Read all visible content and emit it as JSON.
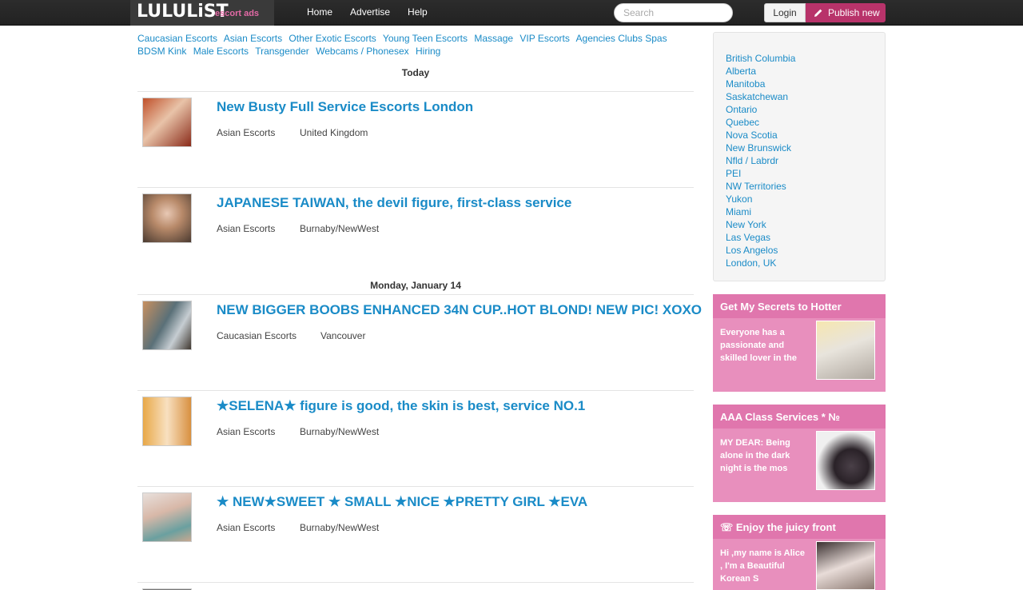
{
  "header": {
    "logo": "LULULiST",
    "logo_sub": "escort ads",
    "nav": [
      "Home",
      "Advertise",
      "Help"
    ],
    "search_placeholder": "Search",
    "login": "Login",
    "publish": "Publish new"
  },
  "categories": [
    "Caucasian Escorts",
    "Asian Escorts",
    "Other Exotic Escorts",
    "Young Teen Escorts",
    "Massage",
    "VIP Escorts",
    "Agencies Clubs Spas",
    "BDSM Kink",
    "Male Escorts",
    "Transgender",
    "Webcams / Phonesex",
    "Hiring"
  ],
  "dates": [
    "Today",
    "Monday, January 14"
  ],
  "listings": [
    {
      "title": "New Busty Full Service Escorts London",
      "category": "Asian Escorts",
      "location": "United Kingdom"
    },
    {
      "title": "JAPANESE TAIWAN, the devil figure, first-class service",
      "category": "Asian Escorts",
      "location": "Burnaby/NewWest"
    },
    {
      "title": "NEW BIGGER BOOBS ENHANCED 34N CUP..HOT BLOND! NEW PIC! XOXO",
      "category": "Caucasian Escorts",
      "location": "Vancouver"
    },
    {
      "title": "★SELENA★ figure is good, the skin is best, service NO.1",
      "category": "Asian Escorts",
      "location": "Burnaby/NewWest"
    },
    {
      "title": "★ NEW★SWEET ★ SMALL ★NICE ★PRETTY GIRL ★EVA",
      "category": "Asian Escorts",
      "location": "Burnaby/NewWest"
    }
  ],
  "regions": [
    "British Columbia",
    "Alberta",
    "Manitoba",
    "Saskatchewan",
    "Ontario",
    "Quebec",
    "Nova Scotia",
    "New Brunswick",
    "Nfld / Labrdr",
    "PEI",
    "NW Territories",
    "Yukon",
    "Miami",
    "New York",
    "Las Vegas",
    "Los Angelos",
    "London, UK"
  ],
  "ads": [
    {
      "title": "Get My Secrets to Hotter",
      "text": "Everyone has a passionate and skilled lover in the"
    },
    {
      "title": "AAA Class Services * №",
      "text": "MY DEAR: Being alone in the dark night is the mos"
    },
    {
      "title": "☏ Enjoy the juicy front",
      "text": "Hi ,my name is Alice , I'm a Beautiful Korean S"
    }
  ],
  "colors": {
    "accent": "#1a8bc7",
    "publish": "#b8336a",
    "ad_bg": "#e88fbd"
  }
}
